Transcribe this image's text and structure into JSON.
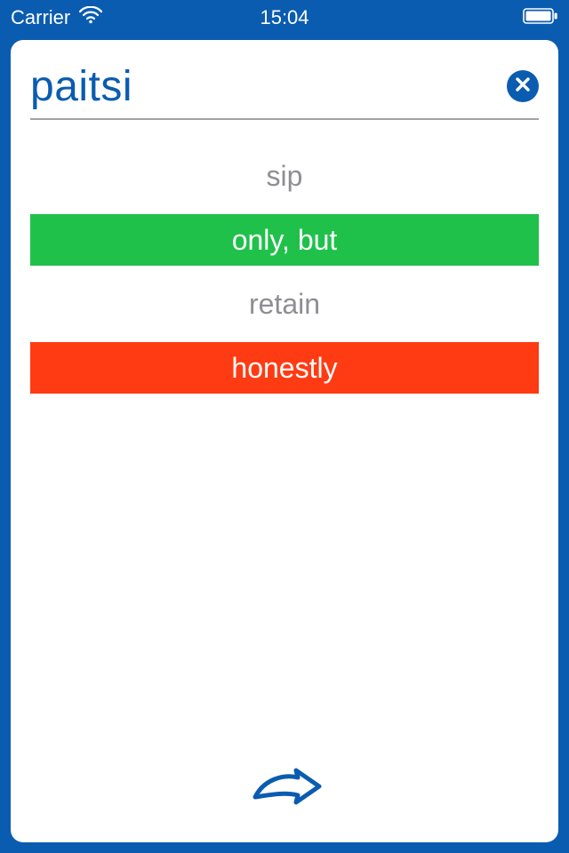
{
  "status_bar": {
    "carrier": "Carrier",
    "time": "15:04"
  },
  "card": {
    "word": "paitsi",
    "answers": [
      {
        "label": "sip",
        "state": "plain"
      },
      {
        "label": "only, but",
        "state": "correct"
      },
      {
        "label": "retain",
        "state": "plain"
      },
      {
        "label": "honestly",
        "state": "wrong"
      }
    ]
  },
  "colors": {
    "brand": "#0a5cb0",
    "correct": "#1fc14b",
    "wrong": "#ff3b13",
    "muted": "#8e8e93"
  }
}
